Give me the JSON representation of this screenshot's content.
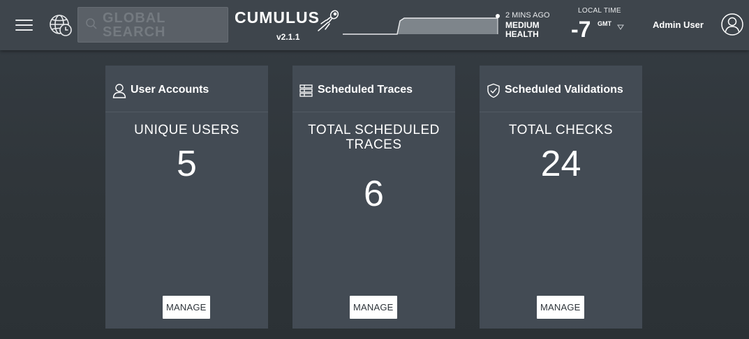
{
  "header": {
    "search": {
      "placeholder": "GLOBAL SEARCH",
      "value": ""
    },
    "brand": {
      "name": "CUMULUS",
      "version": "v2.1.1"
    },
    "health": {
      "updated": "2 MINS AGO",
      "status": "MEDIUM HEALTH"
    },
    "local_time": {
      "label": "LOCAL TIME",
      "offset": "-7",
      "zone": "GMT"
    },
    "user": {
      "name": "Admin User"
    }
  },
  "cards": [
    {
      "title": "User Accounts",
      "icon": "user-icon",
      "metric_label": "UNIQUE USERS",
      "metric_value": "5",
      "action": "MANAGE"
    },
    {
      "title": "Scheduled Traces",
      "icon": "traces-icon",
      "metric_label": "TOTAL SCHEDULED TRACES",
      "metric_value": "6",
      "action": "MANAGE"
    },
    {
      "title": "Scheduled Validations",
      "icon": "shield-check-icon",
      "metric_label": "TOTAL CHECKS",
      "metric_value": "24",
      "action": "MANAGE"
    }
  ],
  "colors": {
    "header_bg": "#3e454c",
    "card_bg": "#434b54",
    "page_bg": "#2f3539",
    "search_bg": "#5a6067"
  }
}
